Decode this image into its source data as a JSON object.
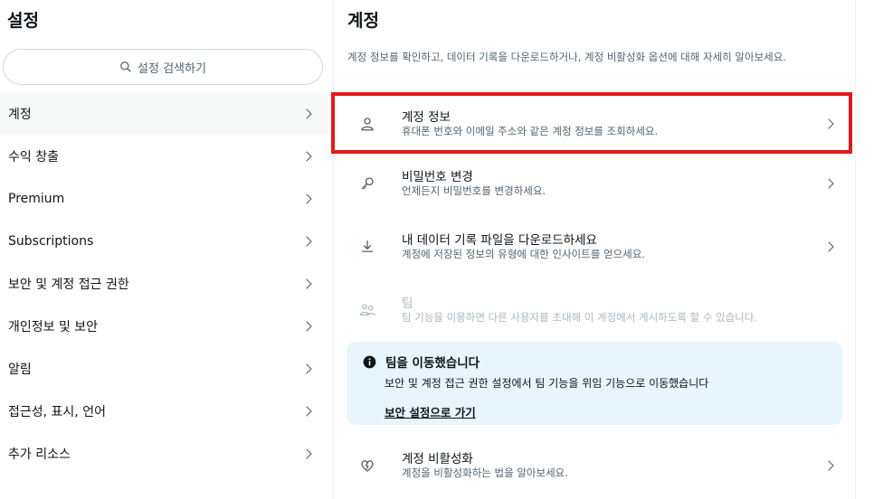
{
  "sidebar": {
    "title": "설정",
    "search_placeholder": "설정 검색하기",
    "items": [
      {
        "label": "계정"
      },
      {
        "label": "수익 창출"
      },
      {
        "label": "Premium"
      },
      {
        "label": "Subscriptions"
      },
      {
        "label": "보안 및 계정 접근 권한"
      },
      {
        "label": "개인정보 및 보안"
      },
      {
        "label": "알림"
      },
      {
        "label": "접근성, 표시, 언어"
      },
      {
        "label": "추가 리소스"
      }
    ]
  },
  "main": {
    "title": "계정",
    "description": "계정 정보를 확인하고, 데이터 기록을 다운로드하거나, 계정 비활성화 옵션에 대해 자세히 알아보세요.",
    "rows": [
      {
        "title": "계정 정보",
        "subtitle": "휴대폰 번호와 이메일 주소와 같은 계정 정보를 조회하세요.",
        "icon": "person-icon"
      },
      {
        "title": "비밀번호 변경",
        "subtitle": "언제든지 비밀번호를 변경하세요.",
        "icon": "key-icon"
      },
      {
        "title": "내 데이터 기록 파일을 다운로드하세요",
        "subtitle": "계정에 저장된 정보의 유형에 대한 인사이트를 얻으세요.",
        "icon": "download-icon"
      },
      {
        "title": "팀",
        "subtitle": "팀 기능을 이용하면 다른 사용자를 초대해 이 계정에서 게시하도록 할 수 있습니다.",
        "icon": "team-icon"
      },
      {
        "title": "계정 비활성화",
        "subtitle": "계정을 비활성화하는 법을 알아보세요.",
        "icon": "broken-heart-icon"
      }
    ],
    "notice": {
      "title": "팀을 이동했습니다",
      "body": "보안 및 계정 접근 권한 설정에서 팀 기능을 위임 기능으로 이동했습니다",
      "link": "보안 설정으로 가기"
    }
  },
  "colors": {
    "highlight": "#e01b1b",
    "notice_bg": "#e8f5fd",
    "active_bg": "#f7f9f9"
  }
}
